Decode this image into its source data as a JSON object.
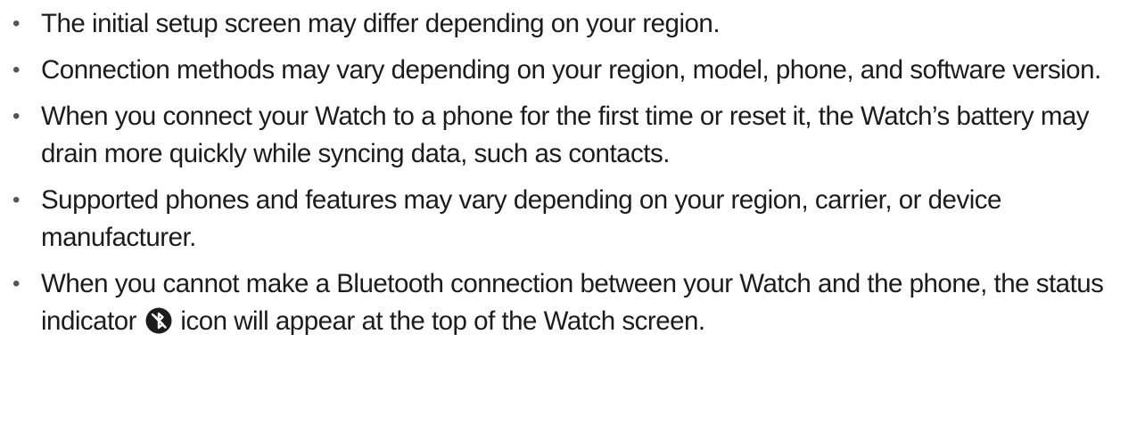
{
  "notes": [
    {
      "bullet": "•",
      "text": "The initial setup screen may differ depending on your region."
    },
    {
      "bullet": "•",
      "text": "Connection methods may vary depending on your region, model, phone, and software version."
    },
    {
      "bullet": "•",
      "text": "When you connect your Watch to a phone for the first time or reset it, the Watch’s battery may drain more quickly while syncing data, such as contacts."
    },
    {
      "bullet": "•",
      "text": "Supported phones and features may vary depending on your region, carrier, or device manufacturer."
    },
    {
      "bullet": "•",
      "text_before_icon": "When you cannot make a Bluetooth connection between your Watch and the phone, the status indicator",
      "icon": "bluetooth-disconnected-icon",
      "text_after_icon": "icon will appear at the top of the Watch screen."
    }
  ]
}
